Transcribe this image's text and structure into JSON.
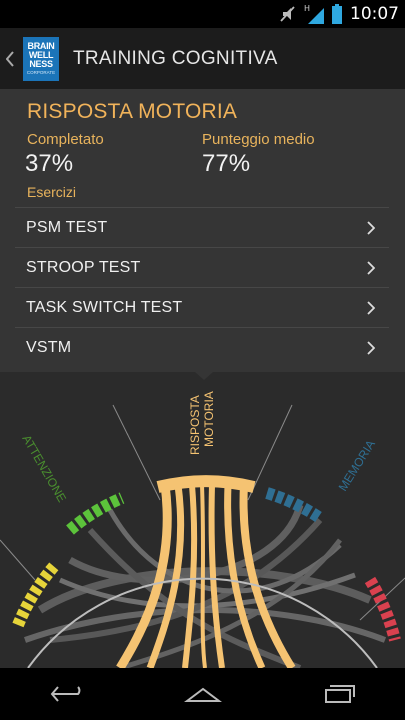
{
  "status_bar": {
    "time": "10:07",
    "network": "H"
  },
  "app_bar": {
    "logo_lines": [
      "BRAIN",
      "WELL",
      "NESS"
    ],
    "logo_sub": "CORPORATE",
    "title": "TRAINING COGNITIVA"
  },
  "panel": {
    "title": "RISPOSTA MOTORIA",
    "completed_label": "Completato",
    "completed_value": "37%",
    "score_label": "Punteggio medio",
    "score_value": "77%",
    "exercises_label": "Esercizi",
    "items": [
      {
        "label": "PSM TEST"
      },
      {
        "label": "STROOP TEST"
      },
      {
        "label": "TASK SWITCH TEST"
      },
      {
        "label": "VSTM"
      }
    ]
  },
  "visualization": {
    "labels": {
      "left": "ATTENZIONE",
      "center_line1": "RISPOSTA",
      "center_line2": "MOTORIA",
      "right": "MEMORIA"
    },
    "colors": {
      "motoria": "#f5c372",
      "attenzione": "#5cc33b",
      "memoria": "#2f6f93",
      "yellow": "#e6d43a",
      "red": "#d9414f",
      "chord": "#6b6b6b"
    }
  }
}
